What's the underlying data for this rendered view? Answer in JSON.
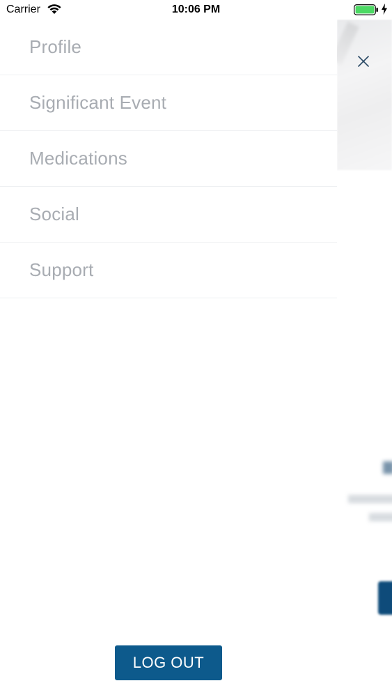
{
  "status_bar": {
    "carrier": "Carrier",
    "time": "10:06 PM",
    "icons": [
      "wifi-icon",
      "battery-icon",
      "charging-icon"
    ]
  },
  "menu": {
    "items": [
      {
        "label": "Profile"
      },
      {
        "label": "Significant Event"
      },
      {
        "label": "Medications"
      },
      {
        "label": "Social"
      },
      {
        "label": "Support"
      }
    ],
    "logout_label": "LOG OUT"
  },
  "background": {
    "close_icon": "close-icon"
  },
  "colors": {
    "menu_text": "#a8acb2",
    "divider": "#eef0f2",
    "logout_bg": "#0d5a8c",
    "close_icon": "#2b4a66",
    "battery_green": "#4cd964"
  }
}
